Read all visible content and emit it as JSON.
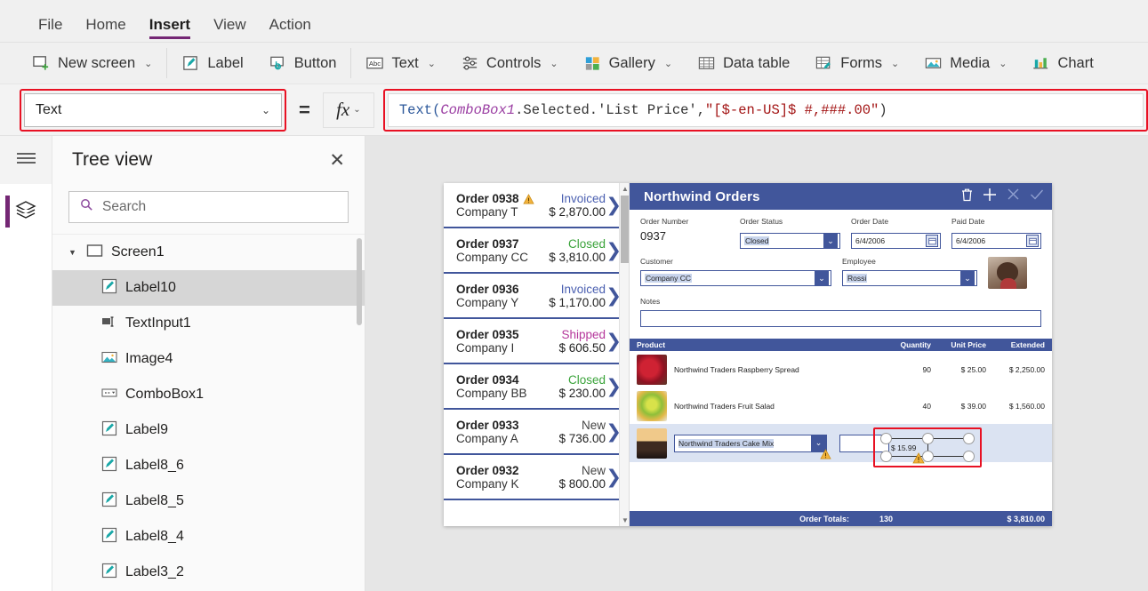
{
  "menu": {
    "items": [
      {
        "label": "File",
        "active": false
      },
      {
        "label": "Home",
        "active": false
      },
      {
        "label": "Insert",
        "active": true
      },
      {
        "label": "View",
        "active": false
      },
      {
        "label": "Action",
        "active": false
      }
    ]
  },
  "ribbon": {
    "items": [
      {
        "label": "New screen",
        "icon": "new-screen-icon",
        "chevron": true
      },
      {
        "label": "Label",
        "icon": "label-icon",
        "chevron": false
      },
      {
        "label": "Button",
        "icon": "button-icon",
        "chevron": false
      },
      {
        "label": "Text",
        "icon": "text-icon",
        "chevron": true
      },
      {
        "label": "Controls",
        "icon": "controls-icon",
        "chevron": true
      },
      {
        "label": "Gallery",
        "icon": "gallery-icon",
        "chevron": true
      },
      {
        "label": "Data table",
        "icon": "data-table-icon",
        "chevron": false
      },
      {
        "label": "Forms",
        "icon": "forms-icon",
        "chevron": true
      },
      {
        "label": "Media",
        "icon": "media-icon",
        "chevron": true
      },
      {
        "label": "Chart",
        "icon": "chart-icon",
        "chevron": false
      }
    ]
  },
  "formula_bar": {
    "property": "Text",
    "equals": "=",
    "fx_label": "fx",
    "formula_tokens": [
      {
        "text": "Text(",
        "type": "fn"
      },
      {
        "text": " ComboBox1",
        "type": "ctrl"
      },
      {
        "text": ".Selected.'List Price', ",
        "type": "plain"
      },
      {
        "text": "\"[$-en-US]$ #,###.00\"",
        "type": "str"
      },
      {
        "text": " )",
        "type": "plain"
      }
    ],
    "formula_plain": "Text( ComboBox1.Selected.'List Price', \"[$-en-US]$ #,###.00\" )",
    "highlight_color": "#e81123"
  },
  "sidebar_rail": {
    "hamburger": "hamburger-icon",
    "tree_view_button": "layers-icon"
  },
  "tree_view": {
    "title": "Tree view",
    "close": "✕",
    "search_placeholder": "Search",
    "search_value": "",
    "items": [
      {
        "label": "Screen1",
        "icon": "screen-icon",
        "level": 0,
        "selected": false,
        "expanded": true
      },
      {
        "label": "Label10",
        "icon": "label-icon",
        "level": 1,
        "selected": true
      },
      {
        "label": "TextInput1",
        "icon": "text-input-icon",
        "level": 1,
        "selected": false
      },
      {
        "label": "Image4",
        "icon": "image-icon",
        "level": 1,
        "selected": false
      },
      {
        "label": "ComboBox1",
        "icon": "combobox-icon",
        "level": 1,
        "selected": false
      },
      {
        "label": "Label9",
        "icon": "label-icon",
        "level": 1,
        "selected": false
      },
      {
        "label": "Label8_6",
        "icon": "label-icon",
        "level": 1,
        "selected": false
      },
      {
        "label": "Label8_5",
        "icon": "label-icon",
        "level": 1,
        "selected": false
      },
      {
        "label": "Label8_4",
        "icon": "label-icon",
        "level": 1,
        "selected": false
      },
      {
        "label": "Label3_2",
        "icon": "label-icon",
        "level": 1,
        "selected": false
      }
    ]
  },
  "app": {
    "title": "Northwind Orders",
    "header_color": "#41569b",
    "actions": [
      {
        "name": "delete-icon",
        "label": "Delete",
        "enabled": true
      },
      {
        "name": "add-icon",
        "label": "New",
        "enabled": true
      },
      {
        "name": "cancel-icon",
        "label": "Cancel",
        "enabled": false
      },
      {
        "name": "check-icon",
        "label": "Save",
        "enabled": false
      }
    ],
    "gallery": {
      "orders": [
        {
          "order": "Order 0938",
          "company": "Company T",
          "status": "Invoiced",
          "amount": "$ 2,870.00",
          "status_color": "#4a5fb0",
          "warning": true
        },
        {
          "order": "Order 0937",
          "company": "Company CC",
          "status": "Closed",
          "amount": "$ 3,810.00",
          "status_color": "#3aa33a",
          "warning": false
        },
        {
          "order": "Order 0936",
          "company": "Company Y",
          "status": "Invoiced",
          "amount": "$ 1,170.00",
          "status_color": "#4a5fb0",
          "warning": false
        },
        {
          "order": "Order 0935",
          "company": "Company I",
          "status": "Shipped",
          "amount": "$ 606.50",
          "status_color": "#b5379b",
          "warning": false
        },
        {
          "order": "Order 0934",
          "company": "Company BB",
          "status": "Closed",
          "amount": "$ 230.00",
          "status_color": "#3aa33a",
          "warning": false
        },
        {
          "order": "Order 0933",
          "company": "Company A",
          "status": "New",
          "amount": "$ 736.00",
          "status_color": "#444444",
          "warning": false
        },
        {
          "order": "Order 0932",
          "company": "Company K",
          "status": "New",
          "amount": "$ 800.00",
          "status_color": "#444444",
          "warning": false
        }
      ]
    },
    "detail": {
      "order_number_label": "Order Number",
      "order_number_value": "0937",
      "order_status_label": "Order Status",
      "order_status_value": "Closed",
      "order_date_label": "Order Date",
      "order_date_value": "6/4/2006",
      "paid_date_label": "Paid Date",
      "paid_date_value": "6/4/2006",
      "customer_label": "Customer",
      "customer_value": "Company CC",
      "employee_label": "Employee",
      "employee_value": "Rossi",
      "notes_label": "Notes",
      "notes_value": ""
    },
    "products": {
      "columns": [
        "Product",
        "Quantity",
        "Unit Price",
        "Extended"
      ],
      "rows": [
        {
          "product": "Northwind Traders Raspberry Spread",
          "quantity": "90",
          "unit_price": "$ 25.00",
          "extended": "$ 2,250.00",
          "thumb": "raspberry-spread-thumbnail"
        },
        {
          "product": "Northwind Traders Fruit Salad",
          "quantity": "40",
          "unit_price": "$ 39.00",
          "extended": "$ 1,560.00",
          "thumb": "fruit-salad-thumbnail"
        }
      ],
      "new_row": {
        "product": "Northwind Traders Cake Mix",
        "quantity": "",
        "selected_label_text": "$ 15.99",
        "thumb": "cake-mix-thumbnail"
      },
      "totals_label": "Order Totals:",
      "totals_quantity": "130",
      "totals_amount": "$ 3,810.00"
    }
  }
}
